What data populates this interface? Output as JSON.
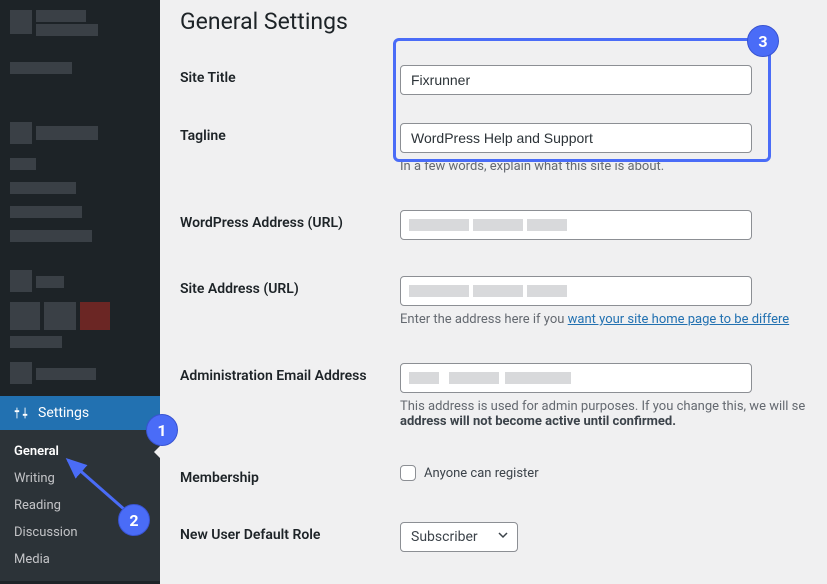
{
  "sidebar": {
    "settings_label": "Settings",
    "submenu": [
      "General",
      "Writing",
      "Reading",
      "Discussion",
      "Media"
    ]
  },
  "page": {
    "title": "General Settings"
  },
  "fields": {
    "site_title": {
      "label": "Site Title",
      "value": "Fixrunner"
    },
    "tagline": {
      "label": "Tagline",
      "value": "WordPress Help and Support",
      "description": "In a few words, explain what this site is about."
    },
    "wp_address": {
      "label": "WordPress Address (URL)"
    },
    "site_address": {
      "label": "Site Address (URL)",
      "description_prefix": "Enter the address here if you ",
      "description_link": "want your site home page to be differe"
    },
    "admin_email": {
      "label": "Administration Email Address",
      "description_prefix": "This address is used for admin purposes. If you change this, we will se",
      "description_bold": "address will not become active until confirmed."
    },
    "membership": {
      "label": "Membership",
      "checkbox_label": "Anyone can register"
    },
    "default_role": {
      "label": "New User Default Role",
      "value": "Subscriber"
    }
  },
  "annotations": {
    "badge1": "1",
    "badge2": "2",
    "badge3": "3"
  }
}
